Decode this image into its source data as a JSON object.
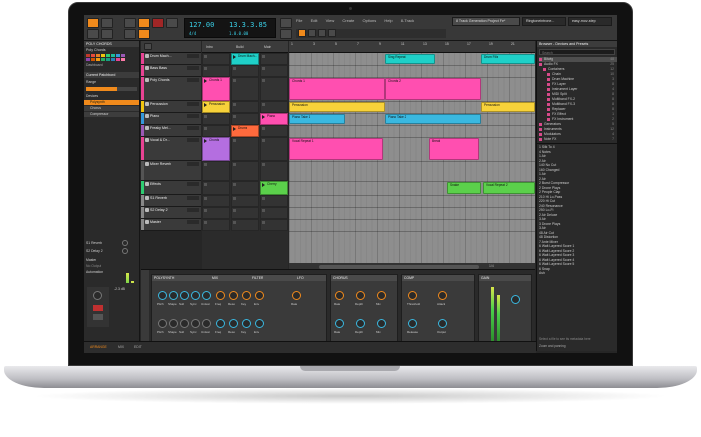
{
  "app": {
    "window_title": "8 Track Generation Project Fe*",
    "menu": [
      "File",
      "Edit",
      "View",
      "Create",
      "Options",
      "Help",
      "8-Track"
    ],
    "file_tabs": [
      "8 Track Generation Project Fe*",
      "Ringtoneintrone...",
      "easy-mov-step"
    ]
  },
  "transport": {
    "tempo": "127.00",
    "time_sig": "4/4",
    "position": "13.3.3.85",
    "loop_position": "1.0.0.00"
  },
  "inspector": {
    "track_name": "POLY CHORDS",
    "instrument": "Poly Chords",
    "dashboard": "Dashboard",
    "current_patchbord": "Current Patchbord",
    "range_label": "Range",
    "devices_label": "Devices",
    "devices": [
      "Polysynth",
      "Chorus",
      "Compressor"
    ],
    "send_a": "S1 Reverb",
    "send_b": "S2 Delay 2",
    "master": "Master",
    "no_output": "No Output",
    "automation": "Automation"
  },
  "swatch_colors": [
    "#c0392b",
    "#e74c3c",
    "#e67e22",
    "#f1c40f",
    "#2ecc71",
    "#1abc9c",
    "#3498db",
    "#9b59b6",
    "#8e44ad",
    "#d35400",
    "#f39c12",
    "#27ae60",
    "#16a085",
    "#2980b9",
    "#e84393",
    "#fd79a8"
  ],
  "tracks": [
    {
      "name": "Drum Mach...",
      "color": "#e84393"
    },
    {
      "name": "Bass Bass",
      "color": "#e84393"
    },
    {
      "name": "Poly Chords",
      "color": "#e84393"
    },
    {
      "name": "Percussion",
      "color": "#f1c40f"
    },
    {
      "name": "Piano",
      "color": "#3498db"
    },
    {
      "name": "Freaky Mel...",
      "color": "#9b59b6"
    },
    {
      "name": "Vocal & Dr...",
      "color": "#e84393"
    },
    {
      "name": "Mixer Reverb",
      "color": "#555555"
    },
    {
      "name": "Effects",
      "color": "#2ecc71"
    },
    {
      "name": "S1 Reverb",
      "color": "#888888"
    },
    {
      "name": "S2 Delay 2",
      "color": "#888888"
    },
    {
      "name": "Master",
      "color": "#888888"
    }
  ],
  "scenes": [
    "Intro",
    "Build",
    "Main"
  ],
  "launcher_clips": [
    {
      "label": "Drum Mach...",
      "color": "#1fd0c8"
    },
    {
      "label": "Chords 1",
      "color": "#ff4fb0"
    },
    {
      "label": "Percussion",
      "color": "#f7d23a"
    },
    {
      "label": "Piano",
      "color": "#ff4fb0"
    },
    {
      "label": "Chords",
      "color": "#b46ee0"
    },
    {
      "label": "Drums",
      "color": "#ff6a3d"
    },
    {
      "label": "Cherry",
      "color": "#5bd04b"
    }
  ],
  "ruler_marks": [
    "1",
    "3",
    "5",
    "7",
    "9",
    "11",
    "13",
    "15",
    "17",
    "19",
    "21"
  ],
  "arranger_clips": [
    {
      "label": "Sing Repeat",
      "color": "#1fd0c8"
    },
    {
      "label": "Drum Fills",
      "color": "#1fd0c8"
    },
    {
      "label": "Chords 1",
      "color": "#ff4fb0"
    },
    {
      "label": "Chords 2",
      "color": "#ff4fb0"
    },
    {
      "label": "Percussion",
      "color": "#f7d23a"
    },
    {
      "label": "Percussion",
      "color": "#f7d23a"
    },
    {
      "label": "Piano Take 1",
      "color": "#3ab8e0"
    },
    {
      "label": "Piano Take 2",
      "color": "#3ab8e0"
    },
    {
      "label": "Break",
      "color": "#ff4fb0"
    },
    {
      "label": "Vocal Repeat 1",
      "color": "#ff4fb0"
    },
    {
      "label": "Snake",
      "color": "#5bd04b"
    },
    {
      "label": "Vocal Repeat 2",
      "color": "#5bd04b"
    }
  ],
  "arranger_zoom": "1/4",
  "browser": {
    "title": "Browser - Devices and Presets",
    "search_placeholder": "Search",
    "categories": [
      {
        "name": "Bitwig",
        "count": "48"
      },
      {
        "name": "Audio FX",
        "count": "25"
      },
      {
        "name": "Containers",
        "count": "12"
      },
      {
        "name": "Chain",
        "count": "10"
      },
      {
        "name": "Drum Machine",
        "count": "3"
      },
      {
        "name": "FX Layer",
        "count": "8"
      },
      {
        "name": "Instrument Layer",
        "count": "4"
      },
      {
        "name": "MIDI Split",
        "count": "8"
      },
      {
        "name": "Multiband FX-2",
        "count": "8"
      },
      {
        "name": "Multiband FX-3",
        "count": "8"
      },
      {
        "name": "Replacer",
        "count": "8"
      },
      {
        "name": "FX Effect",
        "count": "1"
      },
      {
        "name": "FX Instrument",
        "count": "2"
      },
      {
        "name": "Generators",
        "count": "5"
      },
      {
        "name": "Instruments",
        "count": "12"
      },
      {
        "name": "Modulators",
        "count": "4"
      },
      {
        "name": "Note FX",
        "count": "7"
      }
    ],
    "presets": [
      "1 Silk To 4",
      "4 Notes",
      "1 Air",
      "2 Air",
      "140 No Cut",
      "160 Changed",
      "1 Air",
      "2 Air",
      "2 Burst Compressor",
      "2 Drone Plays",
      "2 People Clap",
      "210 Hi Lo-Pass",
      "220 Hi Cut",
      "240 Resonance",
      "250 Lo-Fi",
      "2 Air Deluxe",
      "3 Air",
      "3 Drone Plays",
      "3 Air",
      "48 Air Cut",
      "48 Distortion",
      "7 Ante Mixer",
      "6 Wait Layered Score 1",
      "6 Wait Layered Score 2",
      "6 Wait Layered Score 3",
      "6 Wait Layered Score 4",
      "6 Wait Layered Score 5",
      "6 Snap",
      "Ash"
    ],
    "footer": "Select a file to see its metadata here",
    "zoom_label": "Zoom and panning"
  },
  "device_panel": {
    "polysynth": "POLYSYNTH",
    "osc_labels": [
      "Pitch",
      "Shape",
      "Sub",
      "Sync",
      "Unison"
    ],
    "filter": "FILTER",
    "filter_labels": [
      "Freq",
      "Reso",
      "Key",
      "Env"
    ],
    "mix": "MIX",
    "lfo": "LFO",
    "chorus": "CHORUS",
    "chorus_labels": [
      "Rate",
      "Depth",
      "Mix"
    ],
    "comp": "COMP",
    "comp_labels": [
      "Threshold",
      "Attack",
      "Release",
      "Output"
    ],
    "gain": "GAIN",
    "master_db": "-2.3 dB"
  },
  "statusbar": [
    "ARRANGE",
    "MIX",
    "EDIT"
  ]
}
